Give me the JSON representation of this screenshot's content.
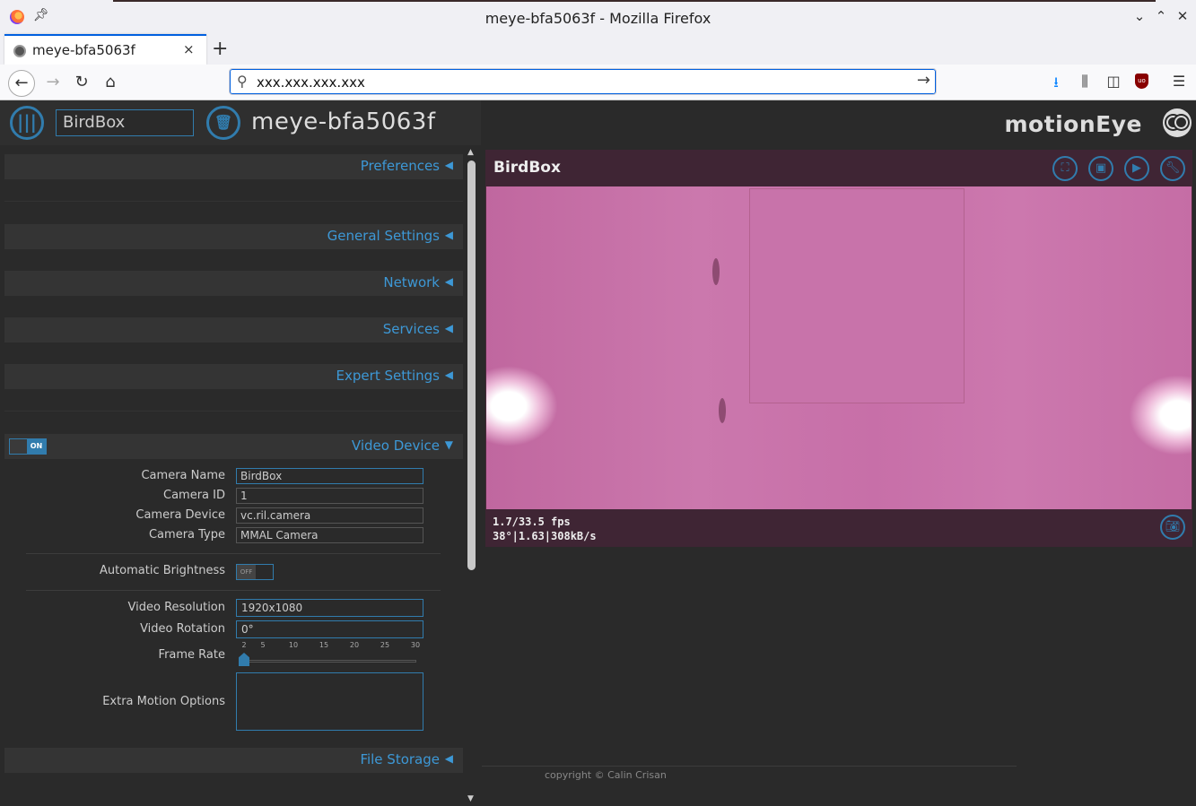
{
  "window": {
    "title": "meye-bfa5063f - Mozilla Firefox",
    "controls": [
      "chevron-down",
      "chevron-up",
      "close"
    ]
  },
  "tabs": [
    {
      "title": "meye-bfa5063f",
      "close": "×"
    }
  ],
  "new_tab": "+",
  "address": {
    "url": "xxx.xxx.xxx.xxx"
  },
  "header": {
    "camera_select": "BirdBox",
    "host": "meye-bfa5063f",
    "brand": "motionEye"
  },
  "sections": [
    {
      "label": "Preferences",
      "expanded": false
    },
    {
      "label": "General Settings",
      "expanded": false
    },
    {
      "label": "Network",
      "expanded": false
    },
    {
      "label": "Services",
      "expanded": false
    },
    {
      "label": "Expert Settings",
      "expanded": false
    },
    {
      "label": "Video Device",
      "expanded": true
    },
    {
      "label": "File Storage",
      "expanded": false
    }
  ],
  "video_device": {
    "toggle": "ON",
    "camera_name_label": "Camera Name",
    "camera_name": "BirdBox",
    "camera_id_label": "Camera ID",
    "camera_id": "1",
    "camera_device_label": "Camera Device",
    "camera_device": "vc.ril.camera",
    "camera_type_label": "Camera Type",
    "camera_type": "MMAL Camera",
    "auto_brightness_label": "Automatic Brightness",
    "auto_brightness": "OFF",
    "video_resolution_label": "Video Resolution",
    "video_resolution": "1920x1080",
    "video_rotation_label": "Video Rotation",
    "video_rotation": "0°",
    "frame_rate_label": "Frame Rate",
    "frame_rate_ticks": [
      "2",
      "5",
      "10",
      "15",
      "20",
      "25",
      "30"
    ],
    "frame_rate_value": 2,
    "extra_motion_label": "Extra Motion Options",
    "extra_motion": ""
  },
  "camera": {
    "name": "BirdBox",
    "fps": "1.7/33.5 fps",
    "stats": "38°|1.63|308kB/s"
  },
  "footer": {
    "copyright": "copyright © Calin Crisan"
  },
  "colors": {
    "accent": "#317cad",
    "link": "#3d98d6",
    "bg": "#2a2a2a"
  }
}
